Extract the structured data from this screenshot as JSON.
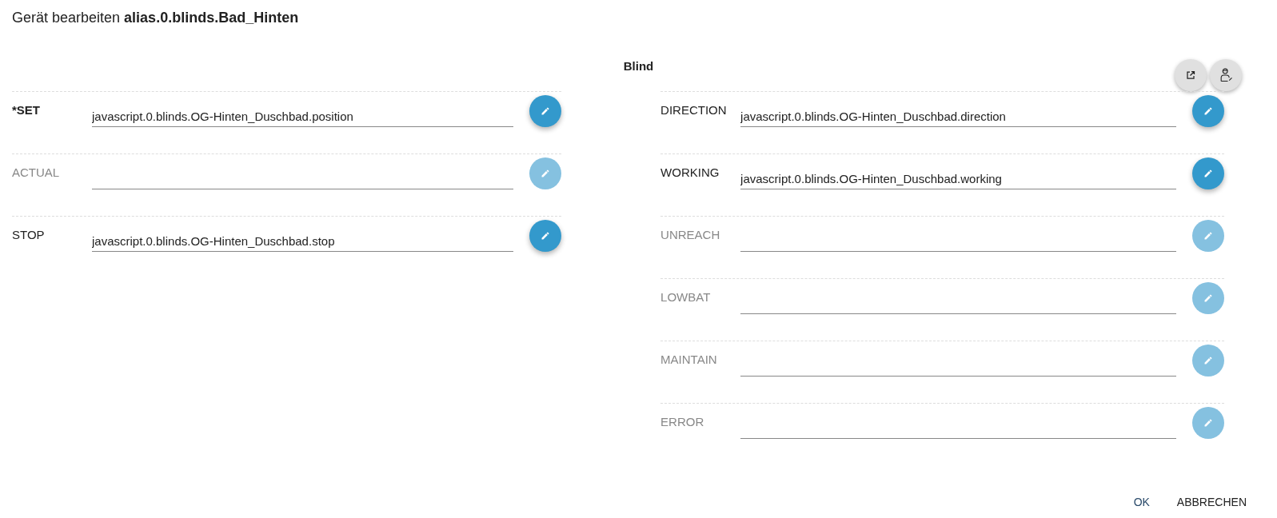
{
  "dialog": {
    "title": "Gerät bearbeiten **alias.0.blinds.Bad_Hinten**",
    "device_type": "Blind"
  },
  "toolbar": [
    {
      "kind": "open"
    },
    {
      "kind": "person"
    }
  ],
  "left_states": [
    {
      "label": "*SET",
      "required": true,
      "active": true,
      "value": "javascript.0.blinds.OG-Hinten_Duschbad.position"
    },
    {
      "label": "ACTUAL",
      "required": false,
      "active": false
    },
    {
      "label": "STOP",
      "required": false,
      "active": true,
      "value": "javascript.0.blinds.OG-Hinten_Duschbad.stop"
    }
  ],
  "right_states": [
    {
      "label": "DIRECTION",
      "required": false,
      "active": true,
      "value": "javascript.0.blinds.OG-Hinten_Duschbad.direction"
    },
    {
      "label": "WORKING",
      "required": false,
      "active": true,
      "value": "javascript.0.blinds.OG-Hinten_Duschbad.working"
    },
    {
      "label": "UNREACH",
      "required": false,
      "active": false
    },
    {
      "label": "LOWBAT",
      "required": false,
      "active": false
    },
    {
      "label": "MAINTAIN",
      "required": false,
      "active": false
    },
    {
      "label": "ERROR",
      "required": false,
      "active": false
    }
  ],
  "buttons": [
    "OK",
    "ABBRECHEN"
  ]
}
